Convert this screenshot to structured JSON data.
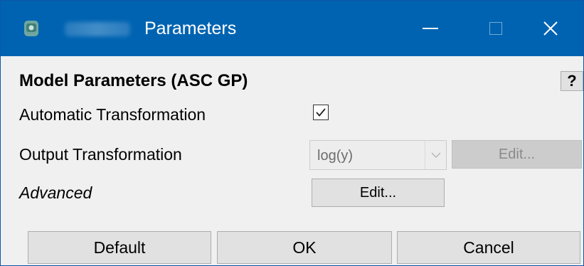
{
  "window": {
    "title": "Parameters",
    "controls": {
      "minimize": "minimize",
      "maximize": "maximize",
      "close": "close"
    }
  },
  "header": {
    "title": "Model Parameters (ASC GP)",
    "help_label": "?"
  },
  "form": {
    "automatic_transformation": {
      "label": "Automatic Transformation",
      "checked": true
    },
    "output_transformation": {
      "label": "Output Transformation",
      "value": "log(y)",
      "edit_label": "Edit...",
      "disabled": true
    },
    "advanced": {
      "label": "Advanced",
      "edit_label": "Edit..."
    }
  },
  "footer": {
    "default_label": "Default",
    "ok_label": "OK",
    "cancel_label": "Cancel"
  },
  "colors": {
    "titlebar": "#0063b1",
    "dialog_bg": "#f0f0f0",
    "button_bg": "#e1e1e1"
  }
}
